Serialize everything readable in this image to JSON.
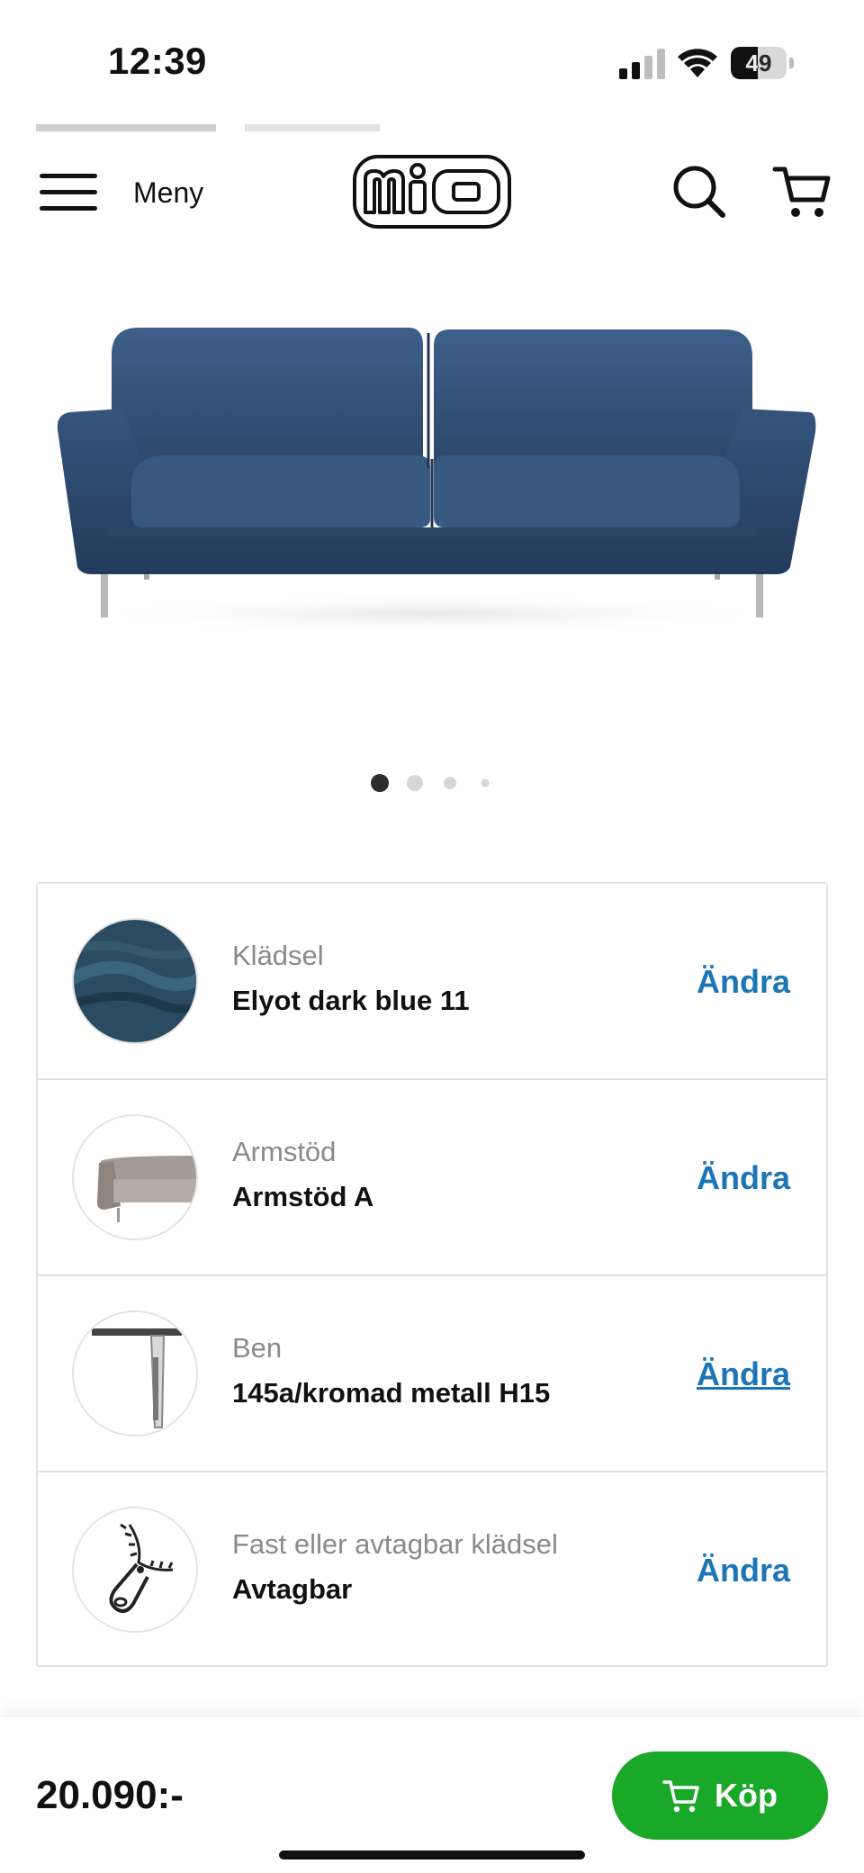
{
  "status_bar": {
    "time": "12:39",
    "battery_level": "49",
    "battery_fraction": 0.49
  },
  "header": {
    "menu_label": "Meny",
    "logo_text": "mio",
    "icons": [
      "hamburger-menu-icon",
      "search-icon",
      "cart-icon"
    ]
  },
  "gallery": {
    "image": "blue-sofa-image",
    "slide_count": 4,
    "active_slide": 1
  },
  "options": [
    {
      "label": "Klädsel",
      "value": "Elyot dark blue 11",
      "action": "Ändra",
      "thumb": "fabric-swatch"
    },
    {
      "label": "Armstöd",
      "value": "Armstöd A",
      "action": "Ändra",
      "thumb": "armrest"
    },
    {
      "label": "Ben",
      "value": "145a/kromad metall H15",
      "action": "Ändra",
      "thumb": "leg"
    },
    {
      "label": "Fast eller avtagbar klädsel",
      "value": "Avtagbar",
      "action": "Ändra",
      "thumb": "zipper-icon"
    }
  ],
  "purchase": {
    "price": "20.090:-",
    "buy_label": "Köp"
  },
  "colors": {
    "accent_link": "#1b75b6",
    "buy_green": "#1aa829",
    "sofa_blue": "#2d4a6e"
  }
}
